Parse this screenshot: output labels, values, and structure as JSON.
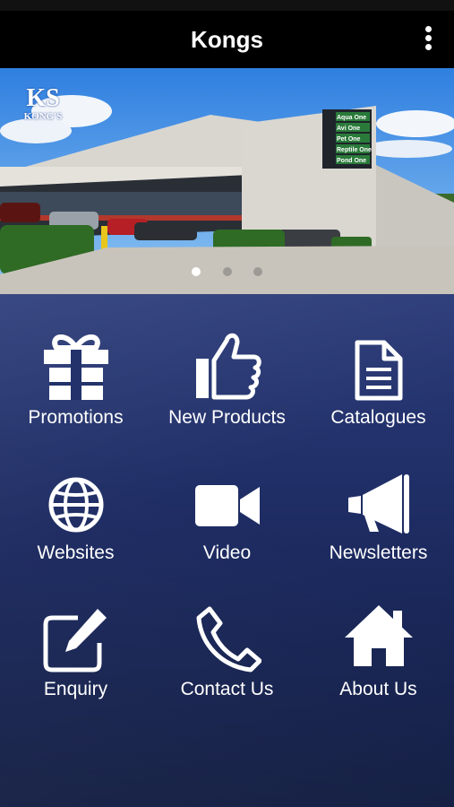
{
  "app": {
    "title": "Kongs"
  },
  "banner": {
    "logo_text": "KS",
    "logo_sub": "KONG'S",
    "signs": [
      "Aqua One",
      "Avi One",
      "Pet One",
      "Reptile One",
      "Pond One"
    ],
    "slides": 3,
    "active_slide": 1
  },
  "menu": {
    "items": [
      {
        "label": "Promotions",
        "icon": "gift-icon"
      },
      {
        "label": "New Products",
        "icon": "thumbs-up-icon"
      },
      {
        "label": "Catalogues",
        "icon": "document-icon"
      },
      {
        "label": "Websites",
        "icon": "globe-icon"
      },
      {
        "label": "Video",
        "icon": "video-camera-icon"
      },
      {
        "label": "Newsletters",
        "icon": "megaphone-icon"
      },
      {
        "label": "Enquiry",
        "icon": "edit-icon"
      },
      {
        "label": "Contact Us",
        "icon": "phone-icon"
      },
      {
        "label": "About Us",
        "icon": "home-icon"
      }
    ]
  }
}
